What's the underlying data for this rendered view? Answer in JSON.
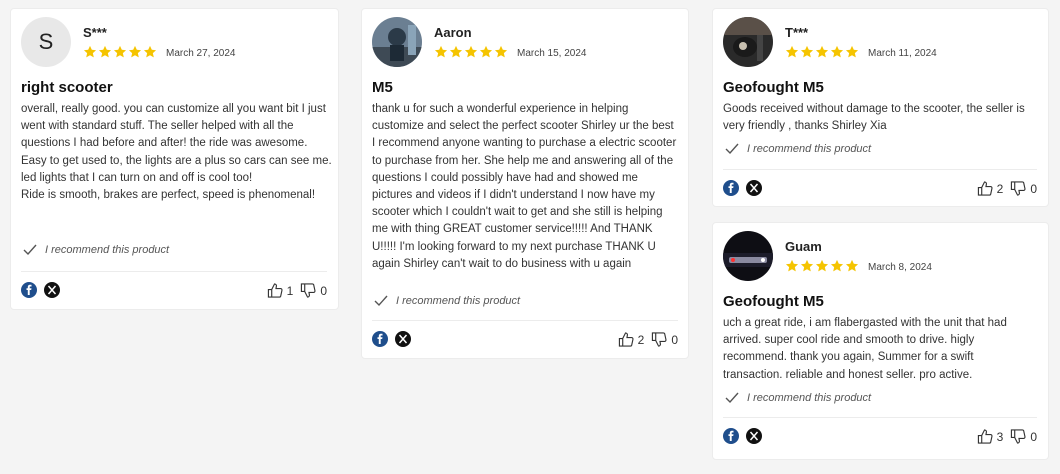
{
  "icons": {
    "star": "star-icon",
    "check": "check-icon",
    "facebook": "facebook-icon",
    "x": "x-icon",
    "thumbs_up": "thumbs-up-icon",
    "thumbs_down": "thumbs-down-icon"
  },
  "colors": {
    "star": "#f5c400",
    "facebook": "#1f4e8c",
    "x": "#111111",
    "background": "#f4f4f4"
  },
  "rating_max": 5,
  "recommend_label": "I recommend this product",
  "reviews": [
    {
      "reviewer": "S***",
      "avatar_initial": "S",
      "rating": 5,
      "date": "March 27, 2024",
      "title": "right scooter",
      "body": "overall, really good. you can customize all you want bit I just went with standard stuff. The seller helped with all the questions I had before and after! the ride was awesome. Easy to get used to, the lights are a plus so cars can see me. led lights that I can turn on and off is cool too!\nRide is smooth, brakes are perfect, speed is phenomenal!",
      "helpful_up": "1",
      "helpful_down": "0"
    },
    {
      "reviewer": "Aaron",
      "avatar_initial": "",
      "rating": 5,
      "date": "March 15, 2024",
      "title": "M5",
      "body": "thank u for such a wonderful experience in helping customize and select the perfect scooter Shirley ur the best I recommend anyone wanting to purchase a electric scooter to purchase from her. She help me and answering all of the questions I could possibly have had and showed me pictures and videos if I didn't understand I now have my scooter which I couldn't wait to get and she still is helping me with thing GREAT customer service!!!!! And THANK U!!!!! I'm looking forward to my next purchase THANK U again Shirley can't wait to do business with u again",
      "helpful_up": "2",
      "helpful_down": "0"
    },
    {
      "reviewer": "T***",
      "avatar_initial": "",
      "rating": 5,
      "date": "March 11, 2024",
      "title": "Geofought M5",
      "body": "Goods received without damage to the scooter, the seller is very friendly , thanks Shirley Xia",
      "helpful_up": "2",
      "helpful_down": "0"
    },
    {
      "reviewer": "Guam",
      "avatar_initial": "",
      "rating": 5,
      "date": "March 8, 2024",
      "title": "Geofought M5",
      "body": "uch a great ride, i am flabergasted with the unit that had arrived. super cool ride and smooth to drive. higly recommend. thank you again, Summer for a swift transaction. reliable and honest seller. pro active.",
      "helpful_up": "3",
      "helpful_down": "0"
    }
  ]
}
